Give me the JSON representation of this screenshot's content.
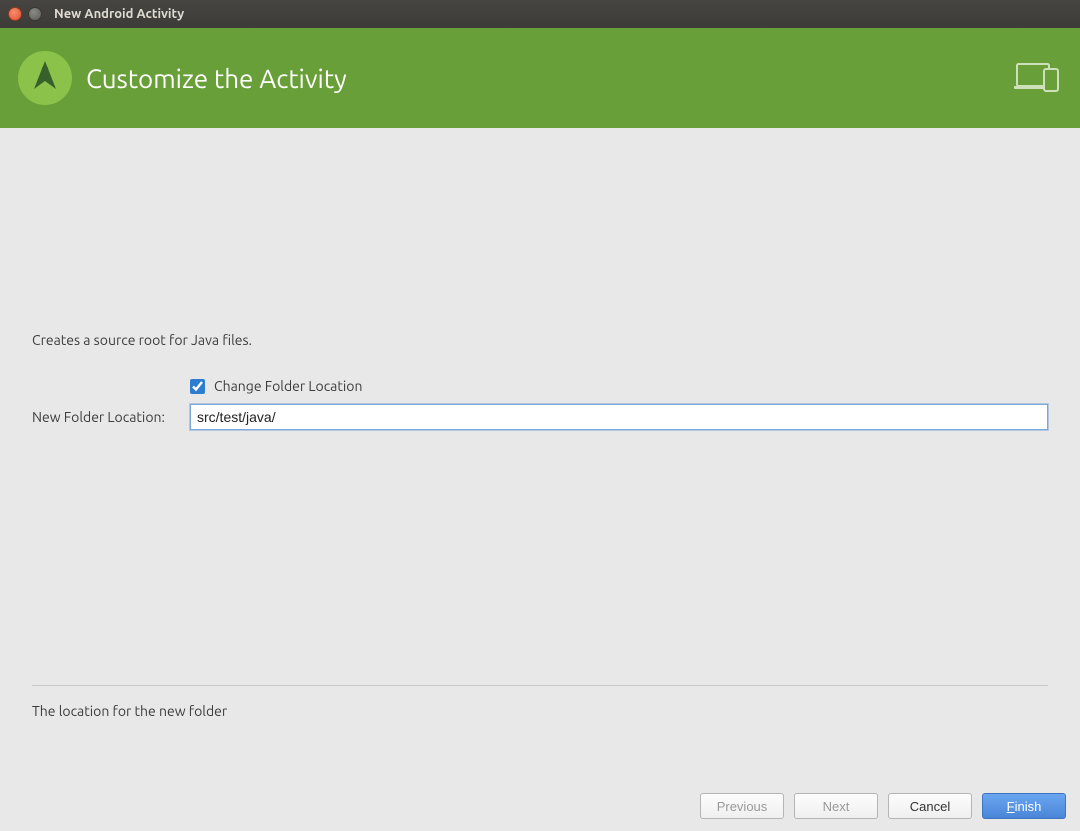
{
  "window": {
    "title": "New Android Activity"
  },
  "banner": {
    "title": "Customize the Activity"
  },
  "content": {
    "description": "Creates a source root for Java files.",
    "checkbox_label": "Change Folder Location",
    "checkbox_checked": true,
    "location_label": "New Folder Location:",
    "location_value": "src/test/java/",
    "hint": "The location for the new folder"
  },
  "buttons": {
    "previous": "Previous",
    "next": "Next",
    "cancel": "Cancel",
    "finish_underline": "F",
    "finish_rest": "inish"
  }
}
